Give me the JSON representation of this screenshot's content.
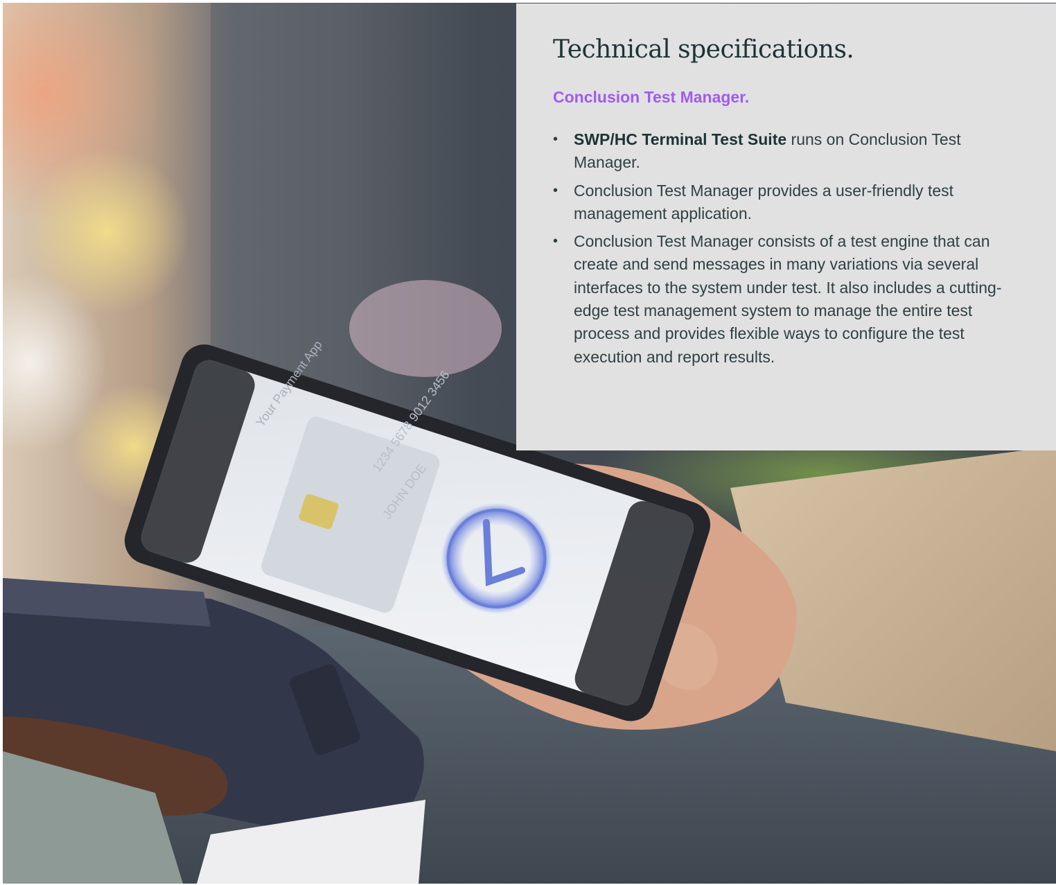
{
  "spec_card": {
    "title": "Technical specifications.",
    "subtitle": "Conclusion Test Manager.",
    "bullet_glyph": "•",
    "items": [
      {
        "strong": "SWP/HC Terminal Test Suite",
        "text": " runs on Conclusion Test Manager."
      },
      {
        "strong": "",
        "text": "Conclusion Test Manager provides a user-friendly test management application."
      },
      {
        "strong": "",
        "text": "Conclusion Test Manager consists of a test engine that can create and send messages in many variations via several interfaces to the system under test. It also includes a cutting-edge test management system to manage the entire test process and provides flexible ways to configure the test execution and report results."
      }
    ]
  },
  "photo": {
    "phone_app_label": "Your Payment App",
    "card_number": "1234 5678 9012 3456",
    "card_name": "JOHN DOE",
    "colors": {
      "card_background": "#e1e1e1",
      "title": "#1e3337",
      "subtitle_accent": "#a05bf0",
      "body_text": "#2f4044"
    }
  }
}
